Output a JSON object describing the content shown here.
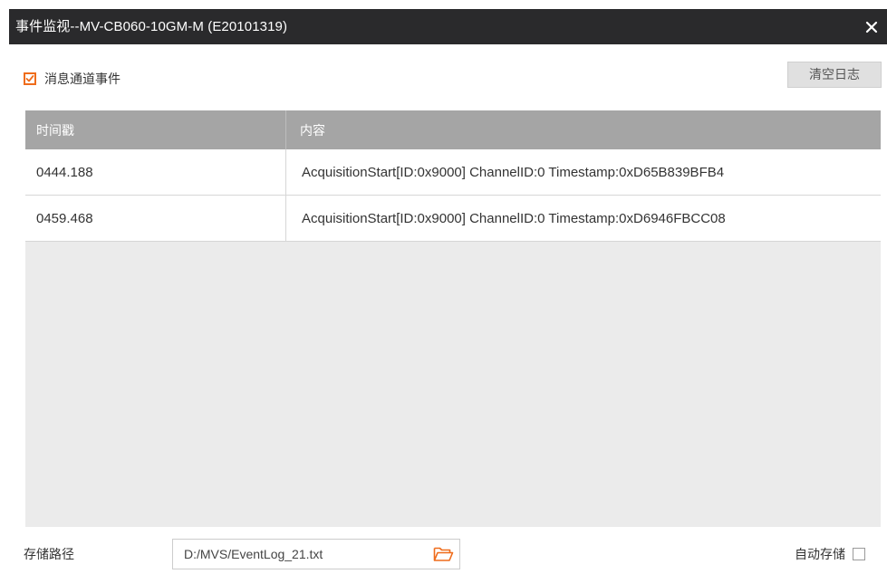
{
  "window": {
    "title": "事件监视--MV-CB060-10GM-M (E20101319)"
  },
  "options": {
    "message_channel_event_label": "消息通道事件",
    "message_channel_event_checked": true,
    "clear_log_label": "清空日志"
  },
  "table": {
    "columns": [
      "时间戳",
      "内容"
    ],
    "rows": [
      {
        "timestamp": "0444.188",
        "content": "AcquisitionStart[ID:0x9000] ChannelID:0 Timestamp:0xD65B839BFB4"
      },
      {
        "timestamp": "0459.468",
        "content": "AcquisitionStart[ID:0x9000] ChannelID:0 Timestamp:0xD6946FBCC08"
      }
    ]
  },
  "footer": {
    "storage_path_label": "存储路径",
    "storage_path_value": "D:/MVS/EventLog_21.txt",
    "auto_save_label": "自动存储",
    "auto_save_checked": false
  },
  "icons": {
    "close": "close-icon",
    "checkbox": "checkmark-icon",
    "folder": "folder-open-icon"
  },
  "colors": {
    "titlebar": "#2a2a2c",
    "accent": "#ef6c1b",
    "table_header": "#a5a5a5",
    "table_body": "#ebebeb"
  }
}
